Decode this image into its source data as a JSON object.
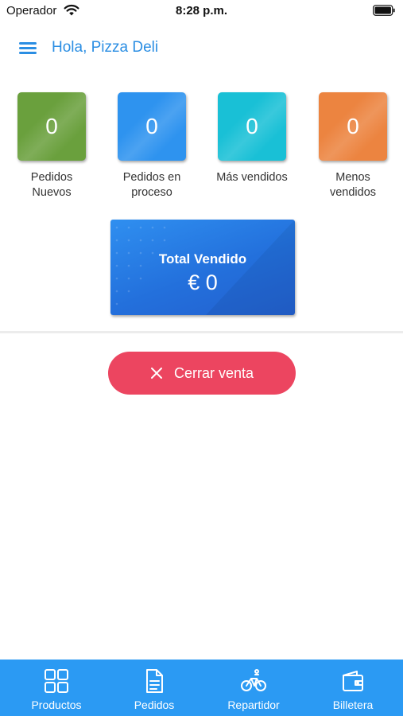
{
  "status_bar": {
    "carrier": "Operador",
    "time": "8:28 p.m."
  },
  "header": {
    "greeting": "Hola, Pizza Deli",
    "menu_icon": "hamburger-menu-icon"
  },
  "stats": [
    {
      "value": "0",
      "label": "Pedidos\nNuevos",
      "color": "#6aa03d"
    },
    {
      "value": "0",
      "label": "Pedidos en\nproceso",
      "color": "#2e93ef"
    },
    {
      "value": "0",
      "label": "Más vendidos",
      "color": "#19c0d6"
    },
    {
      "value": "0",
      "label": "Menos\nvendidos",
      "color": "#ec8440"
    }
  ],
  "total": {
    "title": "Total Vendido",
    "amount": "€ 0"
  },
  "close_sale": {
    "label": "Cerrar venta",
    "icon": "close-icon",
    "color": "#ec4560"
  },
  "bottom_nav": [
    {
      "label": "Productos",
      "icon": "grid-icon"
    },
    {
      "label": "Pedidos",
      "icon": "document-icon"
    },
    {
      "label": "Repartidor",
      "icon": "bicycle-icon"
    },
    {
      "label": "Billetera",
      "icon": "wallet-icon"
    }
  ],
  "colors": {
    "accent": "#2b8ee3",
    "nav_bg": "#2b9af3"
  }
}
